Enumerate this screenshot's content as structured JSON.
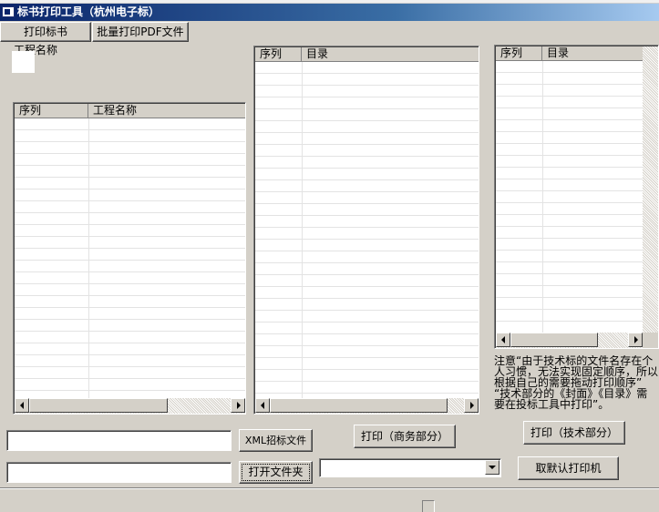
{
  "window": {
    "title": "标书打印工具（杭州电子标）"
  },
  "toolbar": {
    "print_bid_label": "打印标书",
    "batch_print_pdf_label": "批量打印PDF文件"
  },
  "project": {
    "label": "工程名称"
  },
  "project_grid": {
    "columns": [
      "序列",
      "工程名称"
    ]
  },
  "business_grid": {
    "columns": [
      "序列",
      "目录"
    ]
  },
  "tech_grid": {
    "columns": [
      "序列",
      "目录"
    ]
  },
  "buttons": {
    "xml_bid_file": "XML招标文件",
    "open_folder": "打开文件夹",
    "print_business": "打印（商务部分）",
    "print_technical": "打印（技术部分）",
    "default_printer": "取默认打印机"
  },
  "inputs": {
    "xml_path_value": "",
    "folder_path_value": ""
  },
  "printer_select": {
    "selected": ""
  },
  "note": {
    "lines": [
      "注意“由于技术标的文件名存在个",
      "人习惯，无法实现固定顺序，所以",
      "根据自己的需要拖动打印顺序”",
      " “技术部分的《封面》《目录》需",
      "要在投标工具中打印”。"
    ]
  }
}
